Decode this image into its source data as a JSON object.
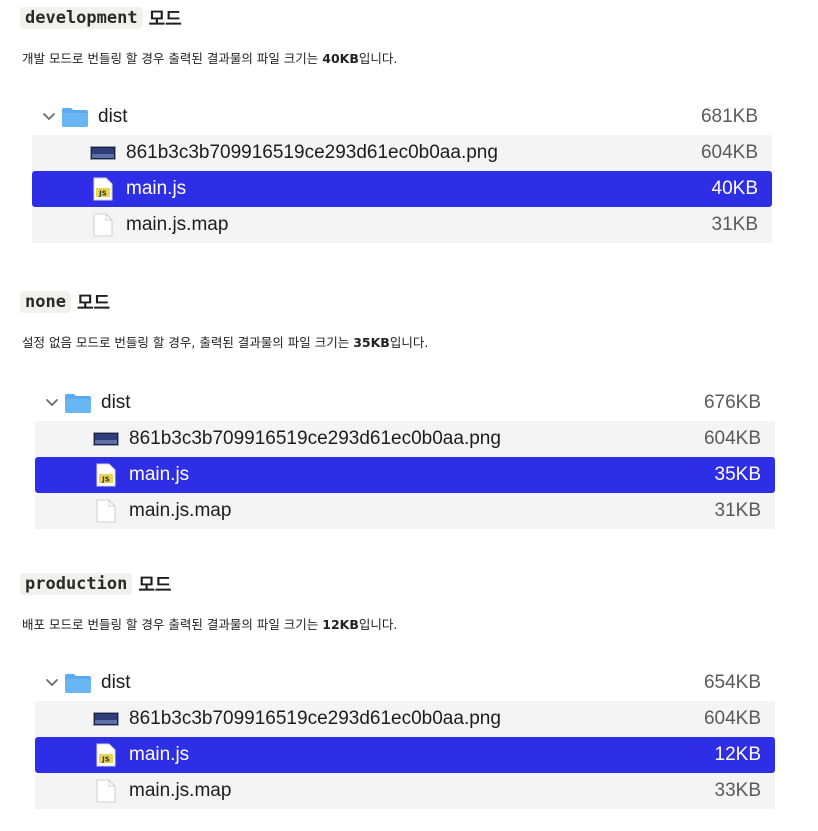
{
  "sections": [
    {
      "code": "development",
      "word": "모드",
      "desc_pre": "개발 모드로 번들링 할 경우 출력된 결과물의 파일 크기는 ",
      "desc_bold": "40KB",
      "desc_post": "입니다.",
      "folder": {
        "name": "dist",
        "size": "681KB"
      },
      "files": [
        {
          "name": "861b3c3b709916519ce293d61ec0b0aa.png",
          "size": "604KB"
        },
        {
          "name": "main.js",
          "size": "40KB"
        },
        {
          "name": "main.js.map",
          "size": "31KB"
        }
      ]
    },
    {
      "code": "none",
      "word": "모드",
      "desc_pre": "설정 없음 모드로 번들링 할 경우, 출력된 결과물의 파일 크기는 ",
      "desc_bold": "35KB",
      "desc_post": "입니다.",
      "folder": {
        "name": "dist",
        "size": "676KB"
      },
      "files": [
        {
          "name": "861b3c3b709916519ce293d61ec0b0aa.png",
          "size": "604KB"
        },
        {
          "name": "main.js",
          "size": "35KB"
        },
        {
          "name": "main.js.map",
          "size": "31KB"
        }
      ]
    },
    {
      "code": "production",
      "word": "모드",
      "desc_pre": "배포 모드로 번들링 할 경우 출력된 결과물의 파일 크기는 ",
      "desc_bold": "12KB",
      "desc_post": "입니다.",
      "folder": {
        "name": "dist",
        "size": "654KB"
      },
      "files": [
        {
          "name": "861b3c3b709916519ce293d61ec0b0aa.png",
          "size": "604KB"
        },
        {
          "name": "main.js",
          "size": "12KB"
        },
        {
          "name": "main.js.map",
          "size": "33KB"
        }
      ]
    }
  ],
  "icons": {
    "chevron": "chevron-down-icon",
    "folder": "folder-icon",
    "image_file": "image-file-icon",
    "js_file": "js-file-icon",
    "map_file": "document-file-icon",
    "js_badge": "JS"
  },
  "colors": {
    "selection": "#2e2ee6",
    "folder_blue": "#5aaaf0",
    "js_yellow": "#e9d44d",
    "alt_row": "#f4f4f4",
    "code_bg": "#f1f1ef"
  }
}
